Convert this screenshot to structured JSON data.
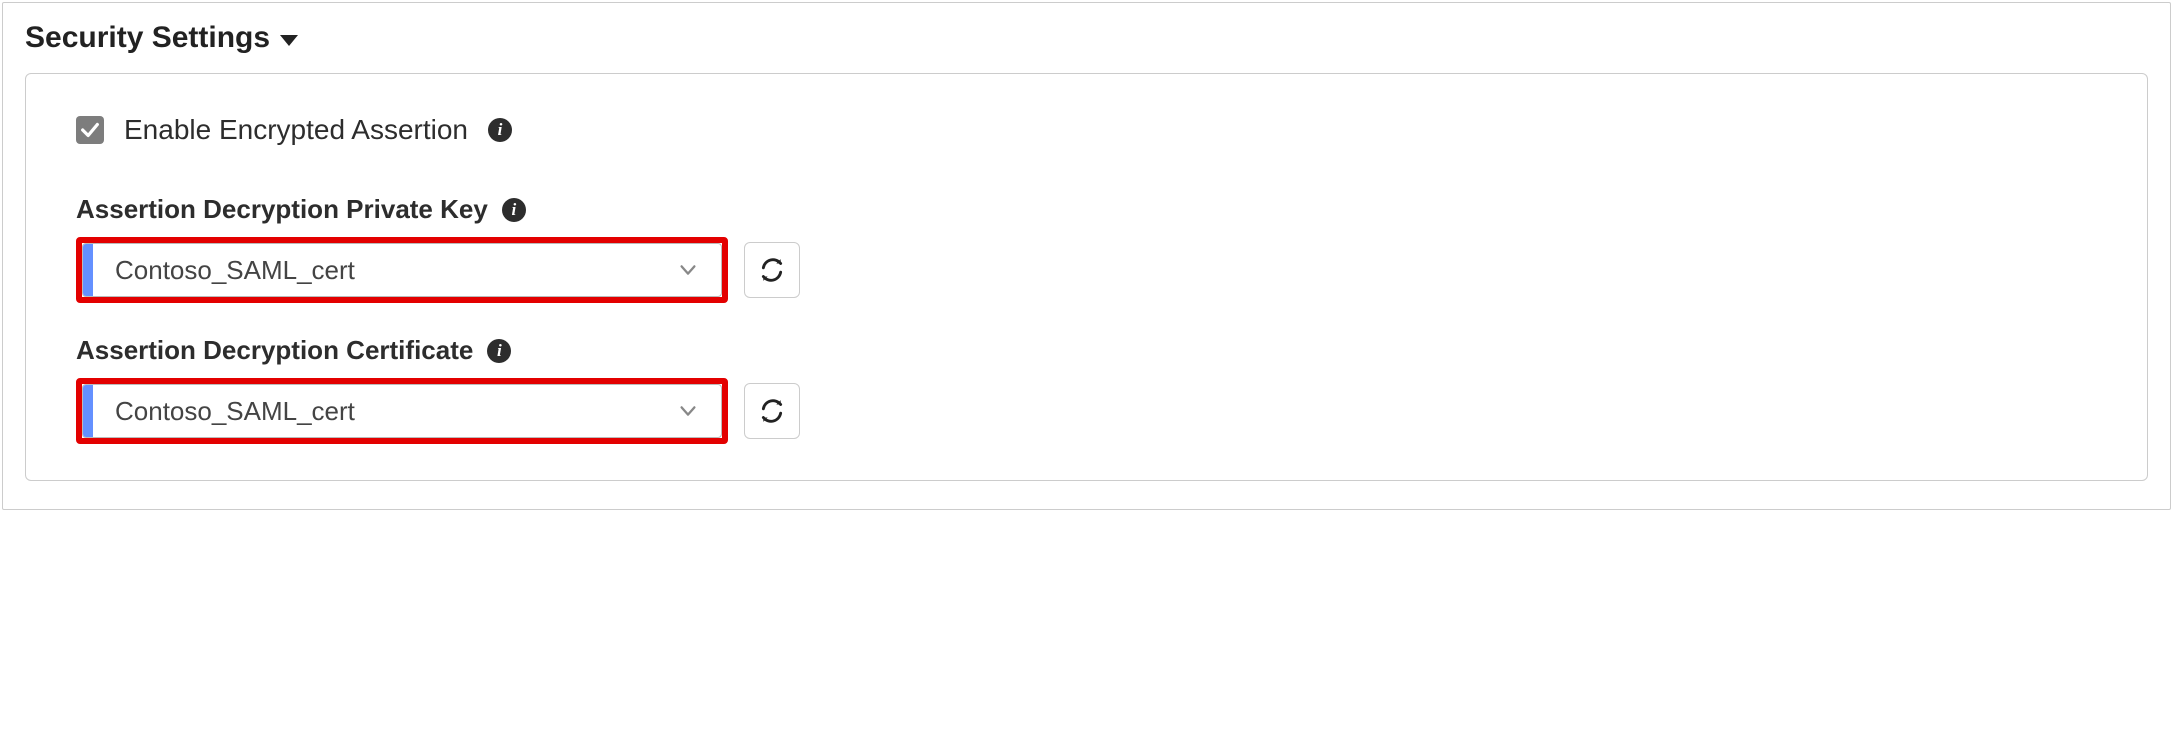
{
  "section": {
    "title": "Security Settings"
  },
  "checkbox": {
    "label": "Enable Encrypted Assertion",
    "checked": true
  },
  "fields": {
    "privateKey": {
      "label": "Assertion Decryption Private Key",
      "value": "Contoso_SAML_cert"
    },
    "certificate": {
      "label": "Assertion Decryption Certificate",
      "value": "Contoso_SAML_cert"
    }
  },
  "icons": {
    "info": "i"
  }
}
